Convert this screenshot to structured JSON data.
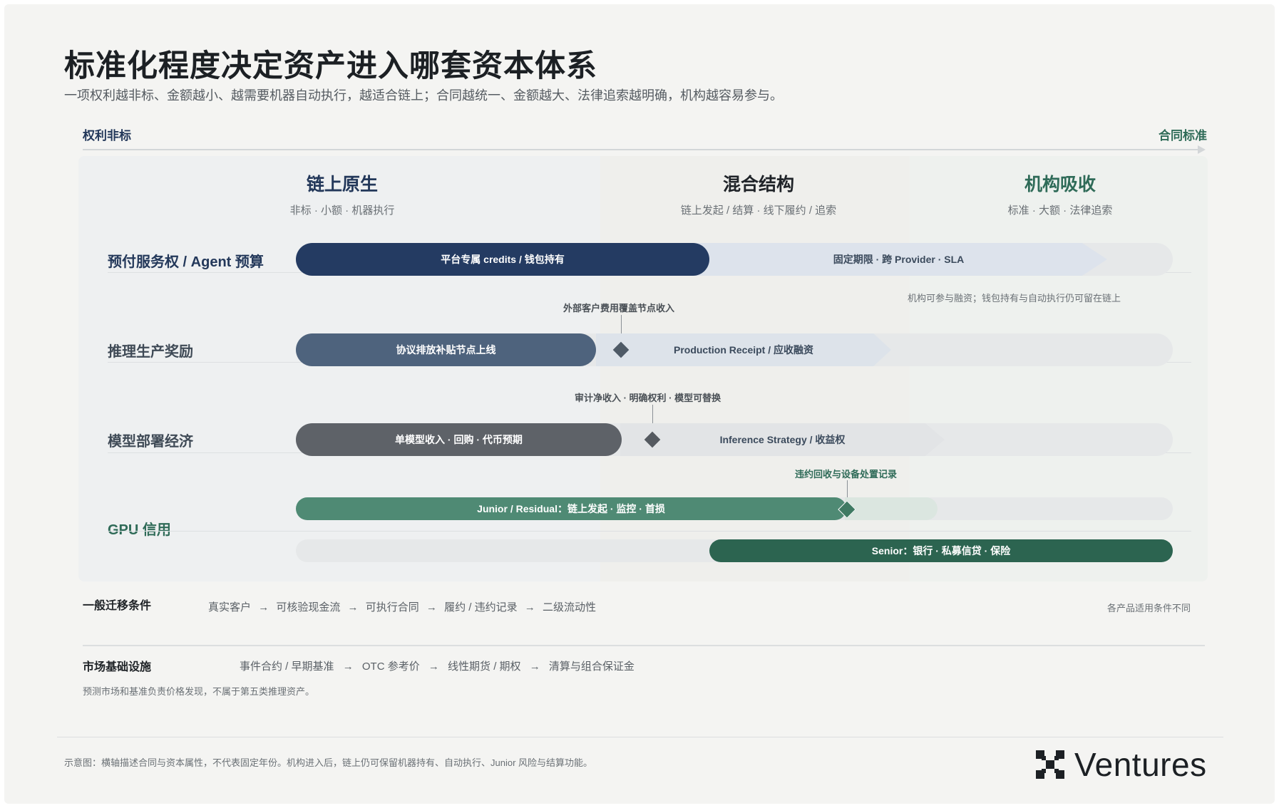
{
  "title": "标准化程度决定资产进入哪套资本体系",
  "subtitle": "一项权利越非标、金额越小、越需要机器自动执行，越适合链上；合同越统一、金额越大、法律追索越明确，机构越容易参与。",
  "axis": {
    "left": "权利非标",
    "right": "合同标准"
  },
  "zones": [
    {
      "title": "链上原生",
      "sub": "非标 · 小额 · 机器执行"
    },
    {
      "title": "混合结构",
      "sub": "链上发起 / 结算 · 线下履约 / 追索"
    },
    {
      "title": "机构吸收",
      "sub": "标准 · 大额 · 法律追索"
    }
  ],
  "rows": {
    "prepaid": {
      "label": "预付服务权 / Agent 预算",
      "bar": "平台专属 credits / 钱包持有",
      "arrow": "固定期限 · 跨 Provider · SLA",
      "note": "机构可参与融资；钱包持有与自动执行仍可留在链上"
    },
    "inference": {
      "label": "推理生产奖励",
      "bar": "协议排放补贴节点上线",
      "callout": "外部客户费用覆盖节点收入",
      "arrow": "Production Receipt / 应收融资"
    },
    "model": {
      "label": "模型部署经济",
      "bar": "单模型收入 · 回购 · 代币预期",
      "callout": "审计净收入 · 明确权利 · 模型可替换",
      "arrow": "Inference Strategy / 收益权"
    },
    "gpu": {
      "label": "GPU 信用",
      "callout": "违约回收与设备处置记录",
      "junior": "Junior / Residual：链上发起 · 监控 · 首损",
      "senior": "Senior：银行 · 私募信贷 · 保险"
    }
  },
  "conditions": {
    "label": "一般迁移条件",
    "steps": [
      "真实客户",
      "可核验现金流",
      "可执行合同",
      "履约 / 违约记录",
      "二级流动性"
    ],
    "arrow": "→",
    "note": "各产品适用条件不同"
  },
  "market": {
    "label": "市场基础设施",
    "steps": [
      "事件合约 / 早期基准",
      "OTC 参考价",
      "线性期货 / 期权",
      "清算与组合保证金"
    ],
    "arrow": "→",
    "note": "预测市场和基准负责价格发现，不属于第五类推理资产。"
  },
  "footer": "示意图：横轴描述合同与资本属性，不代表固定年份。机构进入后，链上仍可保留机器持有、自动执行、Junior 风险与结算功能。",
  "logo": {
    "text": "Ventures",
    "icon": "checker-logo-icon"
  },
  "colors": {
    "navy": "#243b62",
    "slate": "#4e637d",
    "gray": "#5e6268",
    "green": "#4f8a74",
    "dark_green": "#2c6450"
  }
}
